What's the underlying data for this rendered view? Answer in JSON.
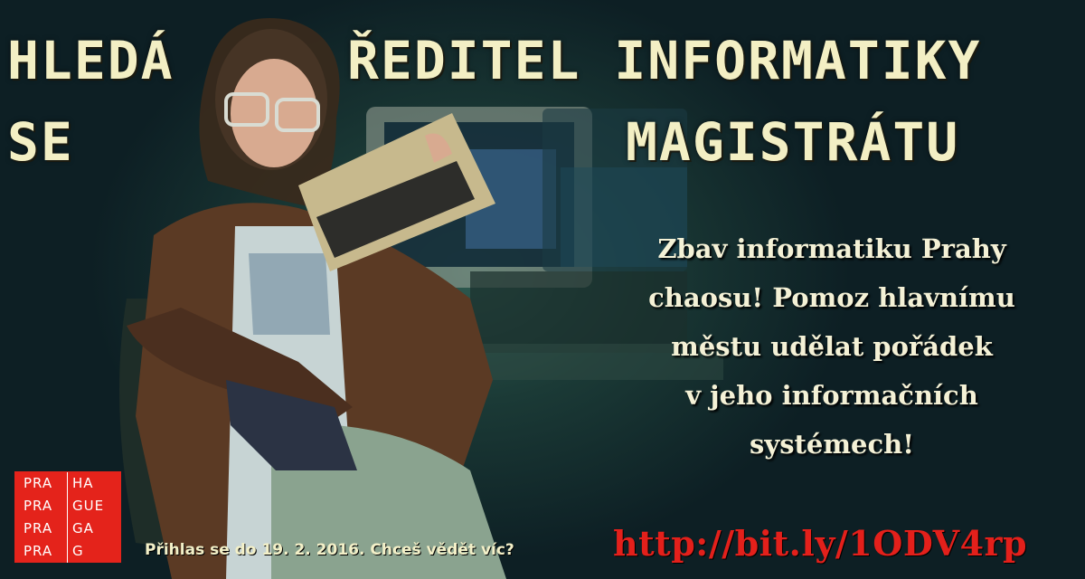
{
  "headline": {
    "left_line1": "HLEDÁ",
    "left_line2": "SE",
    "right_line1": "ŘEDITEL INFORMATIKY",
    "right_line2": "MAGISTRÁTU"
  },
  "pitch_lines": [
    "Zbav informatiku Prahy",
    "chaosu! Pomoz hlavnímu",
    "městu udělat pořádek",
    "v jeho informačních",
    "systémech!"
  ],
  "call_to_action": "Přihlas se do 19. 2. 2016. Chceš vědět víc?",
  "url": "http://bit.ly/1ODV4rp",
  "logo": {
    "rows": [
      [
        "PRA",
        "HA"
      ],
      [
        "PRA",
        "GUE"
      ],
      [
        "PRA",
        "GA"
      ],
      [
        "PRA",
        "G"
      ]
    ]
  },
  "colors": {
    "headline": "#f3efc4",
    "url": "#e3201b",
    "logo_bg": "#e4231b"
  }
}
